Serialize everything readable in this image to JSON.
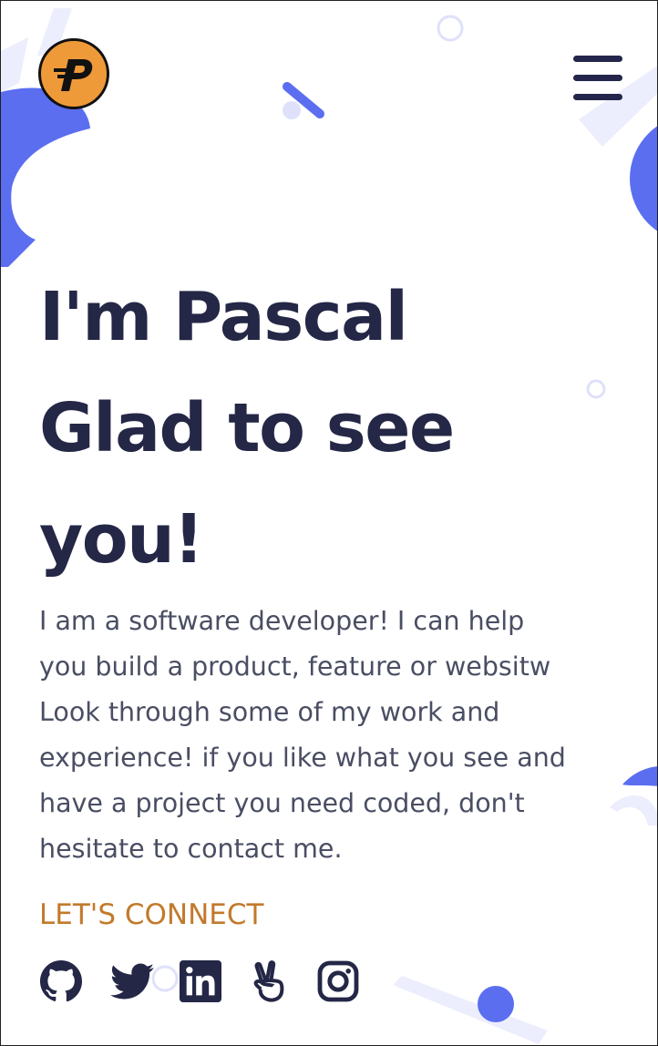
{
  "header": {
    "logo_letter": "P",
    "logo_color": "#ef9a38",
    "menu_icon": "hamburger-menu-icon"
  },
  "hero": {
    "lines": [
      "I'm Pascal",
      "Glad to see",
      "you!"
    ],
    "intro_lines": [
      "I am a software developer! I can help",
      "you build a product, feature or websitw",
      "Look through some of my work and",
      "experience! if you like what you see and",
      "have a project you need coded, don't",
      "hesitate to contact me."
    ],
    "connect_label": "LET'S CONNECT"
  },
  "social": [
    {
      "name": "github-icon"
    },
    {
      "name": "twitter-icon"
    },
    {
      "name": "linkedin-icon"
    },
    {
      "name": "angellist-icon"
    },
    {
      "name": "instagram-icon"
    }
  ],
  "colors": {
    "heading": "#242746",
    "body_text": "#4a4e63",
    "accent": "#c27a2c",
    "decor_blue": "#5b6ef0",
    "decor_light": "#e8e9fd"
  }
}
